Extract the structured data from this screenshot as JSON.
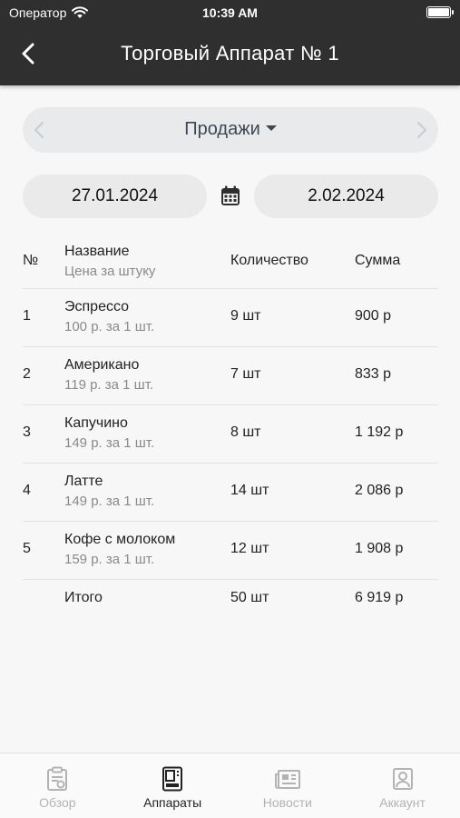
{
  "status": {
    "carrier": "Оператор",
    "time": "10:39 AM"
  },
  "header": {
    "title": "Торговый Аппарат № 1",
    "back_icon": "chevron-left-icon"
  },
  "mode": {
    "label": "Продажи"
  },
  "dates": {
    "from": "27.01.2024",
    "to": "2.02.2024"
  },
  "table": {
    "headers": {
      "num": "№",
      "name": "Название",
      "price": "Цена за штуку",
      "qty": "Количество",
      "sum": "Сумма"
    },
    "rows": [
      {
        "num": "1",
        "name": "Эспрессо",
        "price": "100 р. за 1 шт.",
        "qty": "9 шт",
        "sum": "900 р"
      },
      {
        "num": "2",
        "name": "Американо",
        "price": "119 р. за 1 шт.",
        "qty": "7 шт",
        "sum": "833 р"
      },
      {
        "num": "3",
        "name": "Капучино",
        "price": "149 р. за 1 шт.",
        "qty": "8 шт",
        "sum": "1 192 р"
      },
      {
        "num": "4",
        "name": "Латте",
        "price": "149 р. за 1 шт.",
        "qty": "14 шт",
        "sum": "2 086 р"
      },
      {
        "num": "5",
        "name": "Кофе с молоком",
        "price": "159 р. за 1 шт.",
        "qty": "12 шт",
        "sum": "1 908 р"
      }
    ],
    "total": {
      "label": "Итого",
      "qty": "50 шт",
      "sum": "6 919 р"
    }
  },
  "tabs": [
    {
      "label": "Обзор",
      "icon": "clipboard-icon",
      "active": false
    },
    {
      "label": "Аппараты",
      "icon": "vending-machine-icon",
      "active": true
    },
    {
      "label": "Новости",
      "icon": "newspaper-icon",
      "active": false
    },
    {
      "label": "Аккаунт",
      "icon": "account-icon",
      "active": false
    }
  ],
  "colors": {
    "header_bg": "#2f2f2f",
    "pill_bg": "#e8eaec",
    "active_tab": "#222222",
    "inactive_tab": "#b3b3b3"
  }
}
